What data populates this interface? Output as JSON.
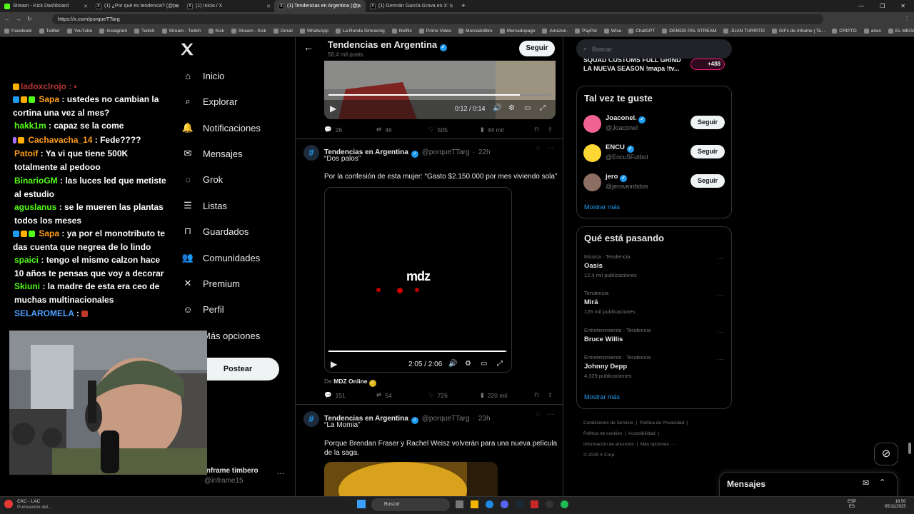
{
  "browser": {
    "tabs": [
      {
        "label": "Stream - Kick Dashboard",
        "fav": "kick"
      },
      {
        "label": "(1) ¿Por qué es tendencia? (@po",
        "fav": "x"
      },
      {
        "label": "(1) Inicio / X",
        "fav": "x"
      },
      {
        "label": "(1) Tendencias en Argentina (@p",
        "fav": "x"
      },
      {
        "label": "(1) Germán García Grova en X: \"",
        "fav": "x"
      }
    ],
    "url": "https://x.com/porqueTTarg",
    "bookmarks": [
      "Facebook",
      "Twitter",
      "YouTube",
      "Instagram",
      "Twitch",
      "Stream - Twitch",
      "Kick",
      "Stream - Kick",
      "Gmail",
      "WhatsApp",
      "La Ronda Simracing",
      "Netflix",
      "Prime Video",
      "Mercadolibre",
      "Mercadopago",
      "Amazon.",
      "PayPal",
      "Wise",
      "ChatGPT",
      "DEMOS PAL STREAM",
      "JUAN TURRITO",
      "GIFs de Inframe | Te...",
      "CRIPTO",
      "aires",
      "EL MEGA PACK PAP..."
    ]
  },
  "chat": {
    "messages": [
      {
        "user": "",
        "text": "",
        "color": "#ff4d4d"
      },
      {
        "user": "Sapa",
        "text": " : ustedes no cambian la cortina una vez al mes?",
        "color": "#ff9f1a"
      },
      {
        "user": "hakk1m",
        "text": " : capaz se la come",
        "color": "#53fc18"
      },
      {
        "user": "Cachavacha_14",
        "text": " : Fede????",
        "color": "#ff9f1a"
      },
      {
        "user": "Patoif",
        "text": " : Ya vi que tiene 500K totalmente al pedooo",
        "color": "#ff9f1a"
      },
      {
        "user": "BinarioGM",
        "text": " : las luces led que metiste al estudio",
        "color": "#53fc18"
      },
      {
        "user": "aguslanus",
        "text": " : se le mueren las plantas todos los meses",
        "color": "#53fc18"
      },
      {
        "user": "Sapa",
        "text": " : ya por el monotributo te das cuenta que negrea de lo lindo",
        "color": "#ff9f1a"
      },
      {
        "user": "spaici",
        "text": " : tengo el mismo calzon hace 10 años te pensas que voy a decorar",
        "color": "#53fc18"
      },
      {
        "user": "Skiuni",
        "text": " : la madre de esta era ceo de muchas multinacionales",
        "color": "#53fc18"
      },
      {
        "user": "SELAROMELA",
        "text": " :",
        "color": "#4d9fff"
      }
    ]
  },
  "nav": {
    "items": [
      {
        "label": "Inicio",
        "icon": "home-icon"
      },
      {
        "label": "Explorar",
        "icon": "search-icon"
      },
      {
        "label": "Notificaciones",
        "icon": "bell-icon"
      },
      {
        "label": "Mensajes",
        "icon": "mail-icon"
      },
      {
        "label": "Grok",
        "icon": "grok-icon"
      },
      {
        "label": "Listas",
        "icon": "list-icon"
      },
      {
        "label": "Guardados",
        "icon": "bookmark-icon"
      },
      {
        "label": "Comunidades",
        "icon": "people-icon"
      },
      {
        "label": "Premium",
        "icon": "x-icon"
      },
      {
        "label": "Perfil",
        "icon": "person-icon"
      },
      {
        "label": "Más opciones",
        "icon": "more-icon"
      }
    ],
    "post_label": "Postear",
    "account_name": "inframe timbero",
    "account_handle": "@inframe15"
  },
  "profile_header": {
    "name": "Tendencias en Argentina",
    "posts": "56,4 mil posts",
    "follow": "Seguir"
  },
  "tweet0": {
    "video_time": "0:12 / 0:14",
    "video_progress": 0.86,
    "replies": "26",
    "retweets": "46",
    "likes": "505",
    "views": "44 mil"
  },
  "tweet1": {
    "name": "Tendencias en Argentina",
    "handle": "@porqueTTarg",
    "age": "22h",
    "title": "“Dos palos”",
    "body": "Por la confesión de esta mujer: “Gasto $2.150.000 por mes viviendo sola”",
    "video_logo": "mdz",
    "video_time": "2:05 / 2:06",
    "video_progress": 0.99,
    "from_label": "De",
    "from_source": "MDZ Online",
    "replies": "151",
    "retweets": "54",
    "likes": "726",
    "views": "220 mil"
  },
  "tweet2": {
    "name": "Tendencias en Argentina",
    "handle": "@porqueTTarg",
    "age": "23h",
    "title": "“La Momia”",
    "body": "Porque Brendan Fraser y Rachel Weisz volverán para una nueva película de la saga."
  },
  "right": {
    "search_placeholder": "Buscar",
    "banner_text": "SQUAD CUSTOMS FULL GRIND LA NUEVA SEASON !mapa !tv...",
    "banner_count": "+488",
    "wtf_title": "Tal vez te guste",
    "suggestions": [
      {
        "name": "Joaconel.",
        "handle": "@Joaconel",
        "follow": "Seguir"
      },
      {
        "name": "ENCU",
        "handle": "@Encu5Futbol",
        "follow": "Seguir"
      },
      {
        "name": "jero",
        "handle": "@jeroveintidos",
        "follow": "Seguir"
      }
    ],
    "show_more": "Mostrar más",
    "trends_title": "Qué está pasando",
    "trends": [
      {
        "context": "Música · Tendencia",
        "name": "Oasis",
        "count": "12,4 mil publicaciones"
      },
      {
        "context": "Tendencia",
        "name": "Mirá",
        "count": "126 mil publicaciones"
      },
      {
        "context": "Entretenimiento · Tendencia",
        "name": "Bruce Willis",
        "count": ""
      },
      {
        "context": "Entretenimiento · Tendencia",
        "name": "Johnny Depp",
        "count": "4.329 publicaciones"
      }
    ],
    "footer": [
      "Condiciones de Servicio",
      "Política de Privacidad",
      "Política de cookies",
      "Accesibilidad",
      "Información de anuncios",
      "Más opciones ···",
      "© 2025 X Corp."
    ],
    "messages_label": "Mensajes"
  },
  "taskbar": {
    "weather_title": "CKC - LAC",
    "weather_sub": "Puntuación del...",
    "search": "Buscar",
    "lang1": "ESP",
    "lang2": "ES",
    "time": "18:50",
    "date": "05/11/2025"
  }
}
